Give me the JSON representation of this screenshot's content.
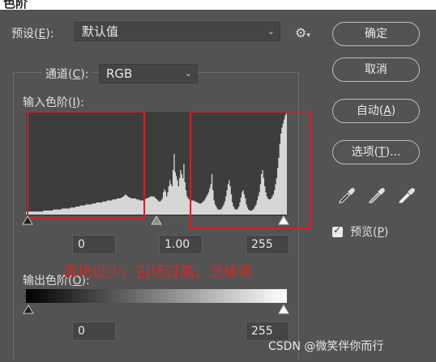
{
  "window": {
    "title": "色阶"
  },
  "preset": {
    "label": "预设(",
    "key": "E",
    "suffix": "):",
    "value": "默认值"
  },
  "buttons": {
    "ok": "确定",
    "cancel": "取消",
    "auto_label": "自动(",
    "auto_key": "A",
    "auto_suffix": ")",
    "options_label": "选项(",
    "options_key": "T",
    "options_suffix": ")..."
  },
  "channel": {
    "label": "通道(",
    "key": "C",
    "suffix": "):",
    "value": "RGB"
  },
  "input_levels": {
    "label": "输入色阶(",
    "key": "I",
    "suffix": "):",
    "black": "0",
    "gamma": "1.00",
    "white": "255"
  },
  "output_levels": {
    "label": "输出色阶(",
    "key": "O",
    "suffix": "):",
    "black": "0",
    "white": "255"
  },
  "preview": {
    "label": "预览(",
    "key": "P",
    "suffix": ")",
    "checked": true
  },
  "annotation": "黑场过少，白场过高，总体亮",
  "watermark": "CSDN @微笑伴你而行",
  "histogram": {
    "bins": [
      3,
      3,
      3,
      3,
      3,
      3,
      3,
      3,
      3,
      3,
      3,
      3,
      3,
      3,
      3,
      3,
      4,
      4,
      4,
      4,
      4,
      4,
      4,
      4,
      4,
      5,
      5,
      5,
      5,
      5,
      5,
      5,
      5,
      6,
      6,
      6,
      6,
      6,
      6,
      6,
      6,
      7,
      7,
      7,
      7,
      7,
      8,
      8,
      8,
      8,
      9,
      9,
      9,
      9,
      9,
      10,
      10,
      10,
      10,
      10,
      10,
      11,
      11,
      11,
      11,
      12,
      12,
      12,
      12,
      12,
      12,
      13,
      13,
      13,
      13,
      14,
      14,
      14,
      14,
      14,
      15,
      15,
      15,
      15,
      16,
      16,
      16,
      16,
      17,
      17,
      18,
      19,
      20,
      19,
      18,
      17,
      17,
      16,
      16,
      16,
      16,
      16,
      15,
      15,
      15,
      14,
      14,
      14,
      14,
      15,
      15,
      16,
      16,
      17,
      17,
      18,
      18,
      18,
      18,
      17,
      16,
      15,
      14,
      13,
      13,
      14,
      16,
      22,
      25,
      23,
      18,
      22,
      28,
      34,
      30,
      28,
      44,
      60,
      42,
      38,
      34,
      28,
      36,
      44,
      40,
      36,
      50,
      32,
      24,
      18,
      16,
      15,
      14,
      14,
      14,
      14,
      13,
      13,
      12,
      12,
      11,
      11,
      11,
      12,
      13,
      14,
      16,
      18,
      20,
      22,
      26,
      30,
      40,
      24,
      14,
      10,
      8,
      6,
      5,
      5,
      5,
      6,
      8,
      10,
      13,
      18,
      24,
      30,
      34,
      28,
      20,
      12,
      8,
      6,
      5,
      5,
      6,
      8,
      12,
      17,
      22,
      24,
      20,
      16,
      10,
      7,
      5,
      4,
      4,
      4,
      5,
      6,
      8,
      10,
      14,
      18,
      22,
      30,
      40,
      44,
      36,
      28,
      22,
      18,
      16,
      15,
      15,
      16,
      18,
      20,
      24,
      30,
      36,
      46,
      56,
      70,
      80,
      86,
      90,
      94,
      98,
      100
    ],
    "color_fill": "#d6d6d6",
    "color_background": "#3d3d3d"
  },
  "colors": {
    "annotation_red": "#d0202a",
    "panel_bg": "#535353"
  }
}
